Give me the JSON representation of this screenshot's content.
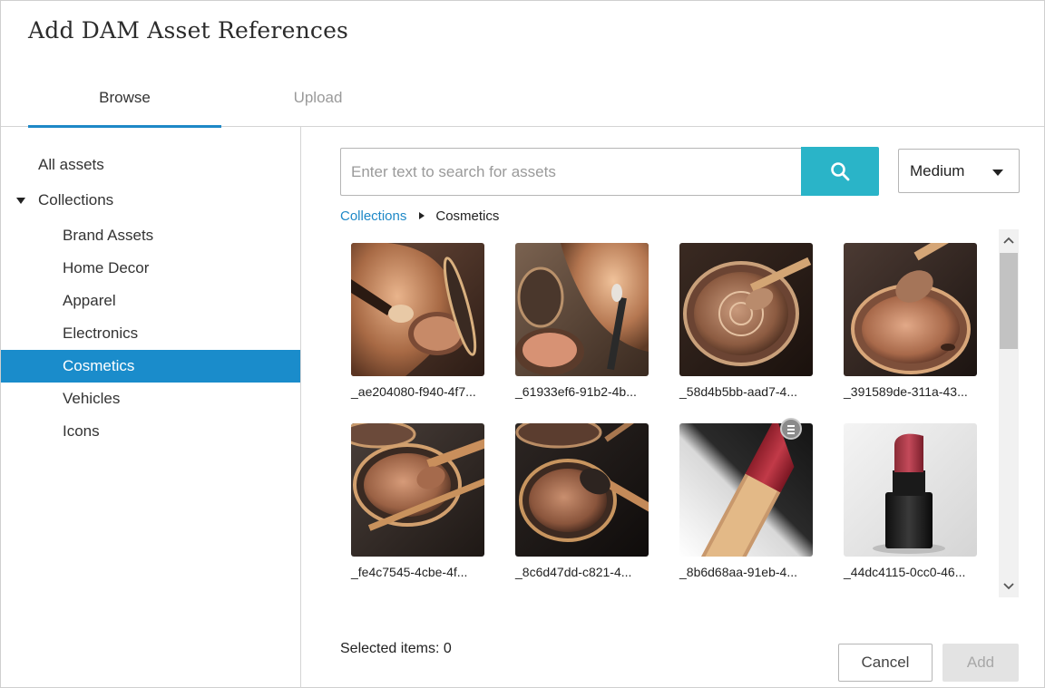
{
  "dialog": {
    "title": "Add DAM Asset References",
    "tabs": [
      {
        "label": "Browse",
        "active": true
      },
      {
        "label": "Upload",
        "active": false
      }
    ]
  },
  "sidebar": {
    "all_assets": "All assets",
    "collections_label": "Collections",
    "collections": [
      {
        "label": "Brand Assets",
        "selected": false
      },
      {
        "label": "Home Decor",
        "selected": false
      },
      {
        "label": "Apparel",
        "selected": false
      },
      {
        "label": "Electronics",
        "selected": false
      },
      {
        "label": "Cosmetics",
        "selected": true
      },
      {
        "label": "Vehicles",
        "selected": false
      },
      {
        "label": "Icons",
        "selected": false
      }
    ]
  },
  "search": {
    "placeholder": "Enter text to search for assets",
    "value": "",
    "button_icon": "search-icon"
  },
  "size_select": {
    "value": "Medium"
  },
  "breadcrumb": {
    "parent": "Collections",
    "current": "Cosmetics"
  },
  "assets": [
    {
      "caption": "_ae204080-f940-4f7...",
      "subject": "face-brush"
    },
    {
      "caption": "_61933ef6-91b2-4b...",
      "subject": "face-compact"
    },
    {
      "caption": "_58d4b5bb-aad7-4...",
      "subject": "compact-brush"
    },
    {
      "caption": "_391589de-311a-43...",
      "subject": "compact-brush"
    },
    {
      "caption": "_fe4c7545-4cbe-4f...",
      "subject": "compact-brush"
    },
    {
      "caption": "_8c6d47dd-c821-4...",
      "subject": "compact-brush"
    },
    {
      "caption": "_8b6d68aa-91eb-4...",
      "subject": "lipstick-closeup",
      "badge": "list-icon"
    },
    {
      "caption": "_44dc4115-0cc0-46...",
      "subject": "lipstick"
    }
  ],
  "footer": {
    "selected_items": "Selected items: 0",
    "cancel_label": "Cancel",
    "add_label": "Add"
  },
  "colors": {
    "accent": "#1e88c7",
    "selected_row": "#1a8ccb",
    "search_button": "#2ab4c8",
    "disabled_button": "#e3e3e3"
  }
}
